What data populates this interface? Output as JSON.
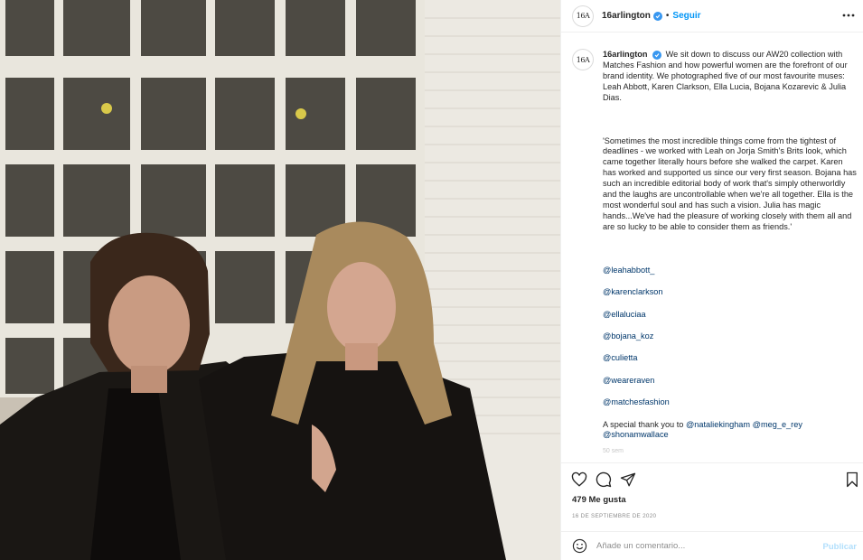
{
  "post": {
    "username": "16arlington",
    "avatar_text": "16A",
    "follow_label": "Seguir",
    "separator": "•",
    "more_icon": "more-options-icon"
  },
  "caption": {
    "username": "16arlington",
    "text": "We sit down to discuss our AW20 collection with Matches Fashion and how powerful women are the forefront of our brand identity. We photographed five of our most favourite muses: Leah Abbott, Karen Clarkson, Ella Lucia, Bojana Kozarevic & Julia Dias.",
    "quote": "'Sometimes the most incredible things come from the tightest of deadlines - we worked with Leah on Jorja Smith's Brits look, which came together literally hours before she walked the carpet. Karen has worked and supported us since our very first season. Bojana has such an incredible editorial body of work that's simply otherworldly and the laughs are uncontrollable when we're all together. Ella is the most wonderful soul and has such a vision. Julia has magic hands...We've had the pleasure of working closely with them all and are so lucky to be able to consider them as friends.'",
    "mentions": [
      "@leahabbott_",
      "@karenclarkson",
      "@ellaluciaa",
      "@bojana_koz",
      "@culietta",
      "@weareraven",
      "@matchesfashion"
    ],
    "thanks_prefix": "A special thank you to ",
    "thanks_mentions": [
      "@nataliekingham",
      "@meg_e_rey",
      "@shonamwallace"
    ],
    "time_ago": "50 sem"
  },
  "actions": {
    "like_icon": "heart-icon",
    "comment_icon": "comment-icon",
    "share_icon": "share-icon",
    "save_icon": "bookmark-icon"
  },
  "likes_text": "479 Me gusta",
  "date_text": "16 de septiembre de 2020",
  "comment_box": {
    "placeholder": "Añade un comentario...",
    "publish_label": "Publicar",
    "emoji_icon": "emoji-icon"
  },
  "colors": {
    "link": "#00376b",
    "follow": "#0095f6",
    "verified": "#3897f0",
    "publish_disabled": "#b2dffc",
    "muted": "#8e8e8e"
  }
}
